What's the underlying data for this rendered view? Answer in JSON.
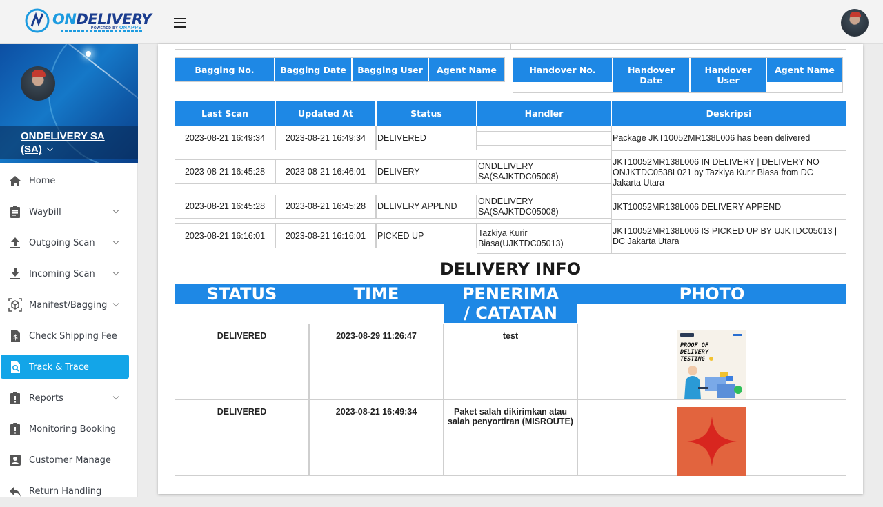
{
  "brand": {
    "logo_on": "ON",
    "logo_delivery": "DELIVERY",
    "logo_powered": "POWERED BY",
    "logo_onapps": "ONAPPS"
  },
  "user": {
    "name": "ONDELIVERY SA (SA)"
  },
  "menu": [
    {
      "label": "Home",
      "icon": "home-icon",
      "has_arrow": false
    },
    {
      "label": "Waybill",
      "icon": "clipboard-icon",
      "has_arrow": true
    },
    {
      "label": "Outgoing Scan",
      "icon": "upload-icon",
      "has_arrow": true
    },
    {
      "label": "Incoming Scan",
      "icon": "download-icon",
      "has_arrow": true
    },
    {
      "label": "Manifest/Bagging",
      "icon": "box-scan-icon",
      "has_arrow": true
    },
    {
      "label": "Check Shipping Fee",
      "icon": "dollar-doc-icon",
      "has_arrow": false
    },
    {
      "label": "Track & Trace",
      "icon": "search-doc-icon",
      "has_arrow": false,
      "active": true
    },
    {
      "label": "Reports",
      "icon": "alert-clipboard-icon",
      "has_arrow": true
    },
    {
      "label": "Monitoring Booking",
      "icon": "alert-clipboard-icon",
      "has_arrow": false
    },
    {
      "label": "Customer Manage",
      "icon": "user-card-icon",
      "has_arrow": false
    },
    {
      "label": "Return Handling",
      "icon": "reply-icon",
      "has_arrow": false
    }
  ],
  "bagging_headers": [
    "Bagging No.",
    "Bagging Date",
    "Bagging User",
    "Agent Name"
  ],
  "handover_headers": [
    "Handover No.",
    "Handover Date",
    "Handover User",
    "Agent Name"
  ],
  "history": {
    "headers": [
      "Last Scan",
      "Updated At",
      "Status",
      "Handler",
      "Deskripsi"
    ],
    "rows": [
      {
        "last_scan": "2023-08-21 16:49:34",
        "updated_at": "2023-08-21 16:49:34",
        "status": "DELIVERED",
        "handler": "",
        "desc": "Package JKT10052MR138L006 has been delivered"
      },
      {
        "last_scan": "2023-08-21 16:45:28",
        "updated_at": "2023-08-21 16:46:01",
        "status": "DELIVERY",
        "handler": "ONDELIVERY SA(SAJKTDC05008)",
        "desc": "JKT10052MR138L006 IN DELIVERY | DELIVERY NO ONJKTDC0538L021 by Tazkiya Kurir Biasa from DC Jakarta Utara"
      },
      {
        "last_scan": "2023-08-21 16:45:28",
        "updated_at": "2023-08-21 16:45:28",
        "status": "DELIVERY APPEND",
        "handler": "ONDELIVERY SA(SAJKTDC05008)",
        "desc": "JKT10052MR138L006 DELIVERY APPEND"
      },
      {
        "last_scan": "2023-08-21 16:16:01",
        "updated_at": "2023-08-21 16:16:01",
        "status": "PICKED UP",
        "handler": "Tazkiya Kurir Biasa(UJKTDC05013)",
        "desc": "JKT10052MR138L006 IS PICKED UP BY UJKTDC05013 | DC Jakarta Utara"
      }
    ]
  },
  "delivery_info": {
    "title": "DELIVERY INFO",
    "headers": [
      "STATUS",
      "TIME",
      "PENERIMA / CATATAN",
      "PHOTO"
    ],
    "rows": [
      {
        "status": "DELIVERED",
        "time": "2023-08-29 11:26:47",
        "note": "test",
        "photo": "proof-of-delivery-testing"
      },
      {
        "status": "DELIVERED",
        "time": "2023-08-21 16:49:34",
        "note": "Paket salah dikirimkan atau salah penyortiran (MISROUTE)",
        "photo": "orange-star"
      }
    ],
    "photo1_text": "PROOF OF DELIVERY TESTING"
  },
  "colors": {
    "header_blue": "#1e88e5",
    "active_menu": "#13a5e8",
    "brand_dark": "#1b3d8f",
    "brand_light": "#1d9be0",
    "photo_orange": "#e2643e",
    "star_red": "#d8261f"
  }
}
